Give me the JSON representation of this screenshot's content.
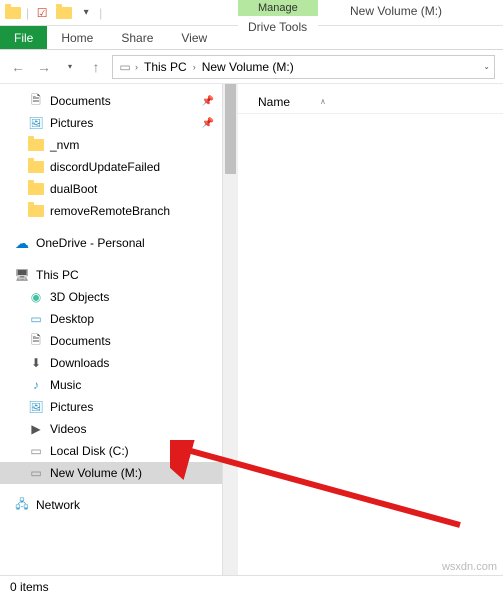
{
  "window_title": "New Volume (M:)",
  "ribbon": {
    "file": "File",
    "home": "Home",
    "share": "Share",
    "view": "View",
    "context_label": "Manage",
    "context_tab": "Drive Tools"
  },
  "address": {
    "crumb1": "This PC",
    "crumb2": "New Volume (M:)"
  },
  "quick": {
    "documents": "Documents",
    "pictures": "Pictures",
    "nvm": "_nvm",
    "discord": "discordUpdateFailed",
    "dualboot": "dualBoot",
    "remove": "removeRemoteBranch"
  },
  "onedrive": "OneDrive - Personal",
  "thispc": {
    "label": "This PC",
    "objects3d": "3D Objects",
    "desktop": "Desktop",
    "documents": "Documents",
    "downloads": "Downloads",
    "music": "Music",
    "pictures": "Pictures",
    "videos": "Videos",
    "localdisk": "Local Disk (C:)",
    "newvol": "New Volume (M:)"
  },
  "network": "Network",
  "list_header": "Name",
  "status": "0 items",
  "watermark": "wsxdn.com"
}
